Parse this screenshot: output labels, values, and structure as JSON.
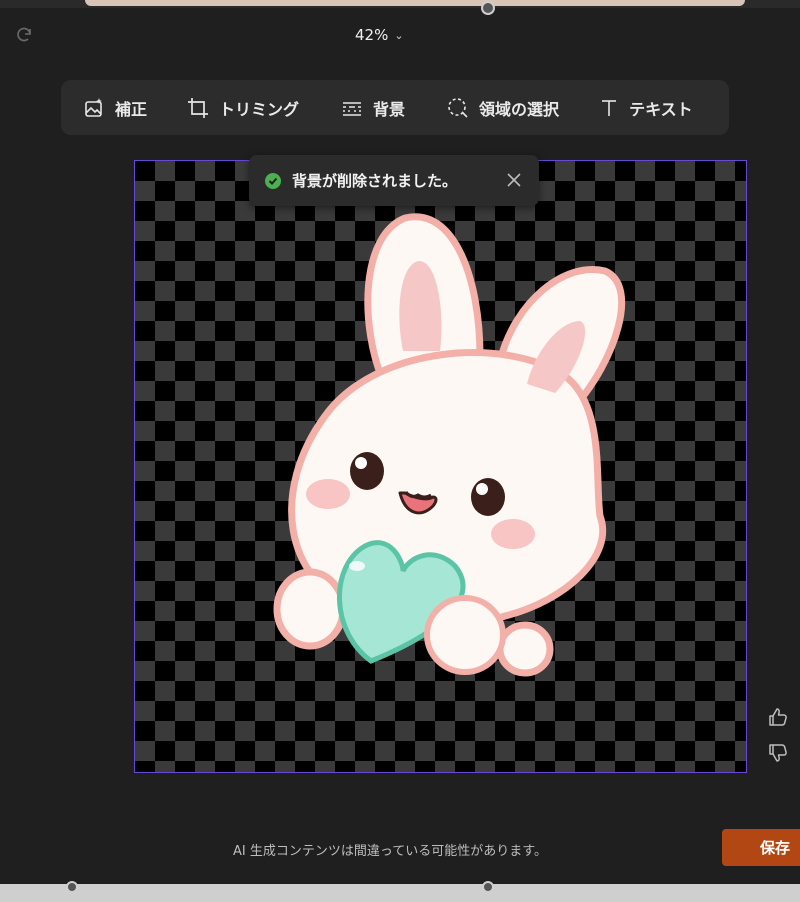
{
  "header": {
    "zoom_label": "42%"
  },
  "toolbar": {
    "tools": [
      {
        "label": "補正",
        "icon": "image-sparkle-icon"
      },
      {
        "label": "トリミング",
        "icon": "crop-icon"
      },
      {
        "label": "背景",
        "icon": "background-icon"
      },
      {
        "label": "領域の選択",
        "icon": "lasso-select-icon"
      },
      {
        "label": "テキスト",
        "icon": "text-icon"
      }
    ]
  },
  "toast": {
    "message": "背景が削除されました。",
    "status_color": "#4caf50"
  },
  "canvas": {
    "selection_border_color": "#6a48d6",
    "image_subject": "cute white bunny holding a mint heart"
  },
  "feedback": {
    "like_icon": "thumbs-up-icon",
    "dislike_icon": "thumbs-down-icon"
  },
  "footer": {
    "disclaimer": "AI 生成コンテンツは間違っている可能性があります。",
    "save_label": "保存",
    "save_color": "#b34714"
  }
}
